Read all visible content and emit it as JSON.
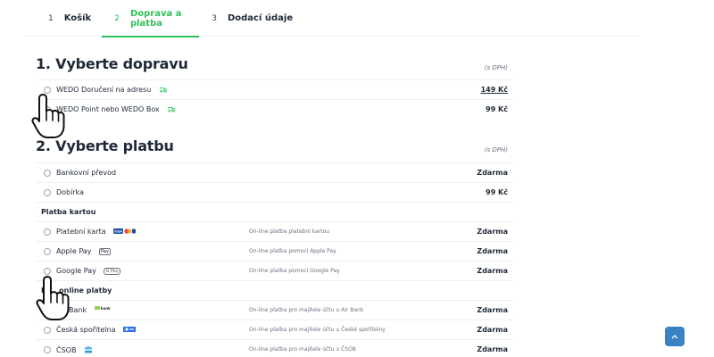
{
  "steps": [
    {
      "num": "1",
      "label": "Košík"
    },
    {
      "num": "2",
      "label": "Doprava a platba"
    },
    {
      "num": "3",
      "label": "Dodací údaje"
    }
  ],
  "shipping": {
    "title": "1. Vyberte dopravu",
    "dph": "(s DPH)",
    "options": [
      {
        "label": "WEDO Doručení na adresu",
        "price": "149 Kč",
        "icon": "truck-icon"
      },
      {
        "label": "WEDO Point nebo WEDO Box",
        "price": "99 Kč",
        "icon": "truck-icon"
      }
    ]
  },
  "payment": {
    "title": "2. Vyberte platbu",
    "dph": "(s DPH)",
    "options": [
      {
        "label": "Bankovní převod",
        "price": "Zdarma"
      },
      {
        "label": "Dobírka",
        "price": "99 Kč"
      }
    ],
    "card_group": {
      "title": "Platba kartou",
      "options": [
        {
          "label": "Platební karta",
          "desc": "On-line platba platební kartou",
          "price": "Zdarma",
          "icon": "card-logos-icon"
        },
        {
          "label": "Apple Pay",
          "desc": "On-line platba pomocí Apple Pay",
          "price": "Zdarma",
          "icon": "apple-pay-icon",
          "badge": "Pay"
        },
        {
          "label": "Google Pay",
          "desc": "On-line platba pomocí Google Pay",
          "price": "Zdarma",
          "icon": "google-pay-icon",
          "badge": "G Pay"
        }
      ]
    },
    "online_group": {
      "title": "R",
      "title_tail": "online platby",
      "options": [
        {
          "label": "Bank",
          "desc": "On-line platba pro majitele účtu u Air Bank",
          "price": "Zdarma",
          "icon": "air-bank-icon",
          "badge": "bank"
        },
        {
          "label": "Česká spořitelna",
          "desc": "On-line platba pro majitele účtu u České spořitelny",
          "price": "Zdarma",
          "icon": "ceska-sporitelna-icon"
        },
        {
          "label": "ČSOB",
          "desc": "On-line platba pro majitele účtu u ČSOB",
          "price": "Zdarma",
          "icon": "csob-icon"
        }
      ]
    }
  },
  "colors": {
    "accent": "#2fbf5a",
    "scroll_button": "#3b82c4"
  }
}
